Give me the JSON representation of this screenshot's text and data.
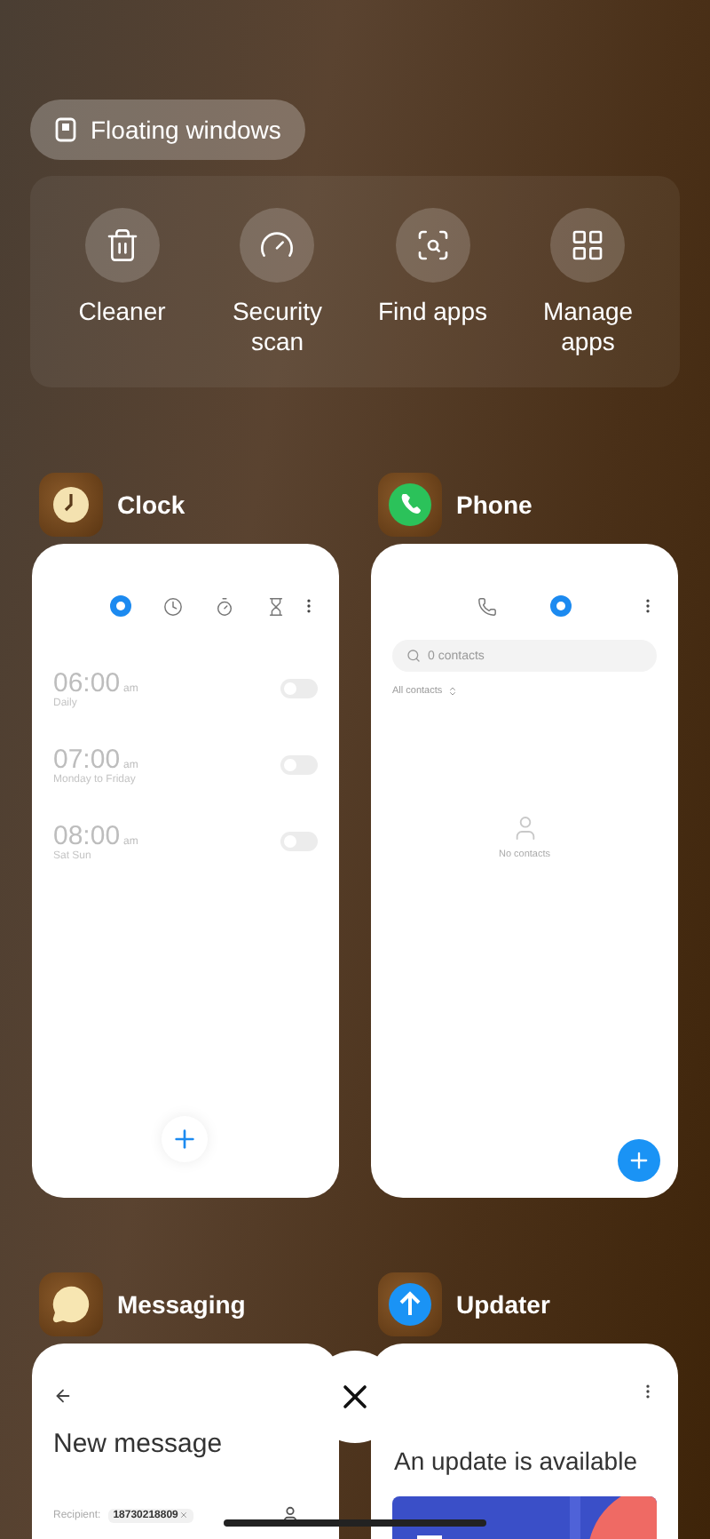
{
  "floating_windows": {
    "label": "Floating windows"
  },
  "tools": [
    {
      "kind": "cleaner",
      "label": "Cleaner"
    },
    {
      "kind": "security",
      "label": "Security scan"
    },
    {
      "kind": "find",
      "label": "Find apps"
    },
    {
      "kind": "manage",
      "label": "Manage apps"
    }
  ],
  "recent_apps": [
    {
      "kind": "clock",
      "name": "Clock",
      "tabs": [
        {
          "selected": true
        },
        {
          "selected": false
        },
        {
          "selected": false
        },
        {
          "selected": false
        }
      ],
      "alarms": [
        {
          "time": "06:00",
          "meridiem": "am",
          "repeat": "Daily",
          "on": false
        },
        {
          "time": "07:00",
          "meridiem": "am",
          "repeat": "Monday to Friday",
          "on": false
        },
        {
          "time": "08:00",
          "meridiem": "am",
          "repeat": "Sat Sun",
          "on": false
        }
      ]
    },
    {
      "kind": "phone",
      "name": "Phone",
      "tabs": [
        {
          "selected": false
        },
        {
          "selected": true
        }
      ],
      "search": {
        "placeholder": "0 contacts"
      },
      "filter": "All contacts",
      "empty": "No contacts"
    },
    {
      "kind": "messaging",
      "name": "Messaging",
      "title": "New message",
      "recipient_label": "Recipient:",
      "recipient": "18730218809"
    },
    {
      "kind": "updater",
      "name": "Updater",
      "title": "An update is available"
    }
  ]
}
